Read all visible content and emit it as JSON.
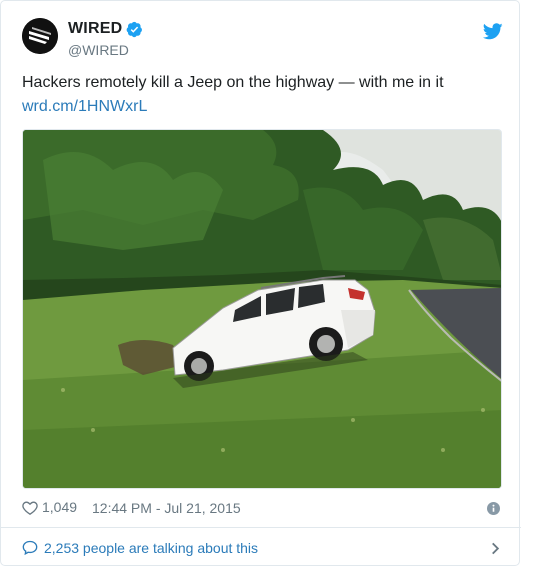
{
  "author": {
    "display_name": "WIRED",
    "handle": "@WIRED",
    "verified": true
  },
  "tweet": {
    "text": "Hackers remotely kill a Jeep on the highway — with me in it",
    "link": "wrd.cm/1HNWxrL"
  },
  "stats": {
    "likes": "1,049",
    "timestamp": "12:44 PM - Jul 21, 2015"
  },
  "footer": {
    "conversation": "2,253 people are talking about this"
  },
  "icons": {
    "verified": "verified-badge-icon",
    "brand": "twitter-bird-icon",
    "like": "heart-icon",
    "info": "info-icon",
    "reply": "speech-bubble-icon",
    "chevron": "chevron-right-icon"
  },
  "colors": {
    "link": "#2b7bb9",
    "verified": "#1da1f2",
    "muted": "#697882",
    "border": "#e1e8ed"
  }
}
